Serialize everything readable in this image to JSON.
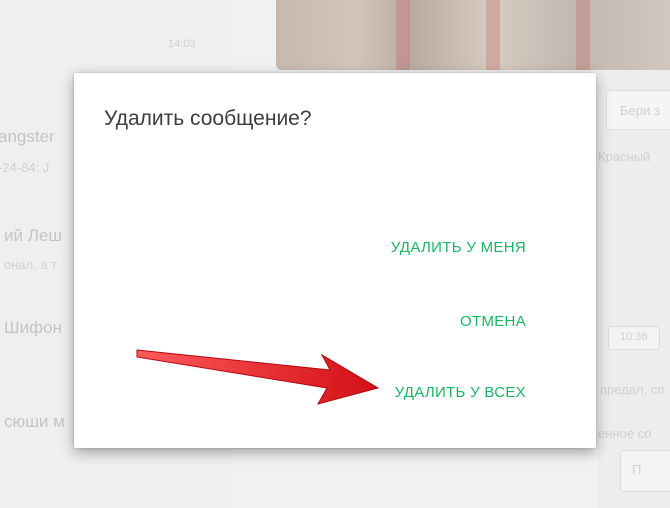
{
  "background": {
    "chat_time": "14:03",
    "right_input_hint": "Бери з",
    "right_line_1": "Красный",
    "right_time": "10:36",
    "right_line_2": "предал, сп",
    "right_line_3": "енное со",
    "right_button": "П",
    "chats": [
      {
        "name": "angster",
        "sub": "-24-84: J"
      },
      {
        "name": "ий Леш",
        "sub": "онал, а т"
      },
      {
        "name": "Шифон",
        "sub": ""
      },
      {
        "name": "сюши м",
        "sub": ""
      }
    ]
  },
  "dialog": {
    "title": "Удалить сообщение?",
    "actions": {
      "delete_for_me": "УДАЛИТЬ У МЕНЯ",
      "cancel": "ОТМЕНА",
      "delete_for_all": "УДАЛИТЬ У ВСЕХ"
    },
    "accent_color": "#1ab564"
  },
  "annotation": {
    "arrow_color": "#e8141b",
    "icon": "red-arrow-icon"
  }
}
